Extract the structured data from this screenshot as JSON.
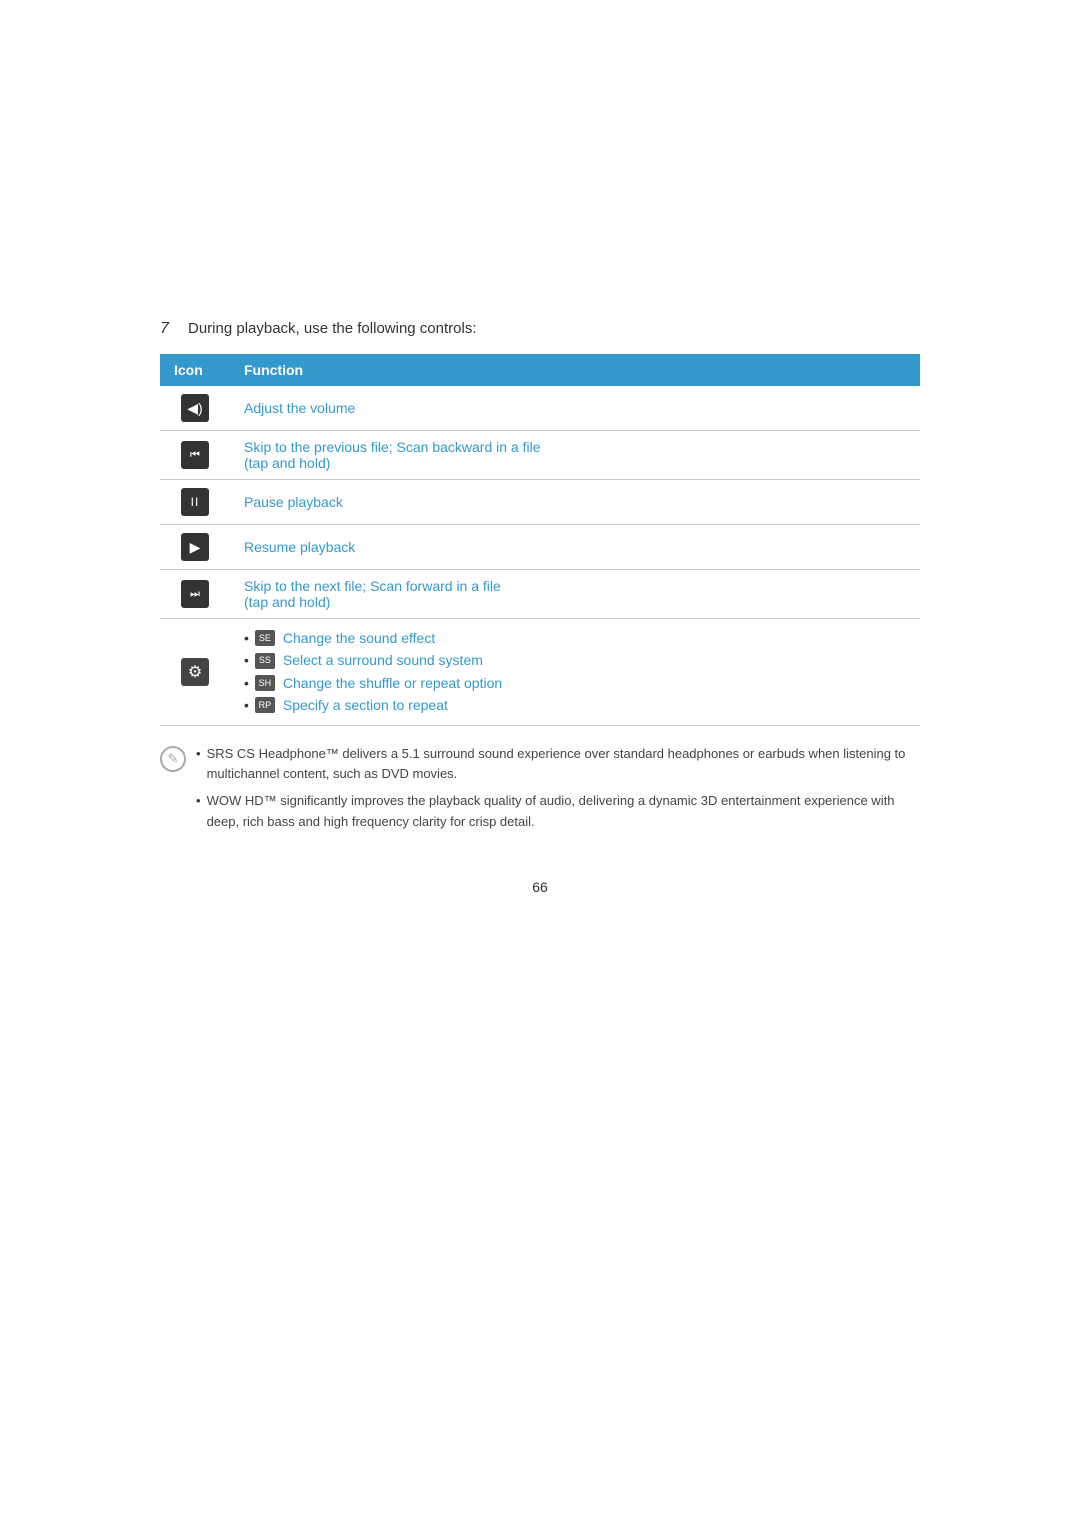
{
  "step": {
    "number": "7",
    "text": "During playback, use the following controls:"
  },
  "table": {
    "header": {
      "icon_col": "Icon",
      "function_col": "Function"
    },
    "rows": [
      {
        "icon": "volume",
        "icon_symbol": "◀)",
        "function": "Adjust the volume"
      },
      {
        "icon": "skip-back",
        "icon_symbol": "|◀◀",
        "function": "Skip to the previous file; Scan backward in a file\n(tap and hold)"
      },
      {
        "icon": "pause",
        "icon_symbol": "II",
        "function": "Pause playback"
      },
      {
        "icon": "play",
        "icon_symbol": "▶",
        "function": "Resume playback"
      },
      {
        "icon": "skip-forward",
        "icon_symbol": "▶▶|",
        "function": "Skip to the next file; Scan forward in a file\n(tap and hold)"
      },
      {
        "icon": "gear",
        "icon_symbol": "⚙",
        "function_bullets": [
          {
            "mini_label": "SE",
            "text": "Change the sound effect"
          },
          {
            "mini_label": "SS",
            "text": "Select a surround sound system"
          },
          {
            "mini_label": "SH",
            "text": "Change the shuffle or repeat option"
          },
          {
            "mini_label": "RP",
            "text": "Specify a section to repeat"
          }
        ]
      }
    ]
  },
  "notes": [
    "SRS CS Headphone™ delivers a 5.1 surround sound experience over standard headphones or earbuds when listening to multichannel content, such as DVD movies.",
    "WOW HD™ significantly improves the playback quality of audio, delivering a dynamic 3D entertainment experience with deep, rich bass and high frequency clarity for crisp detail."
  ],
  "page_number": "66"
}
